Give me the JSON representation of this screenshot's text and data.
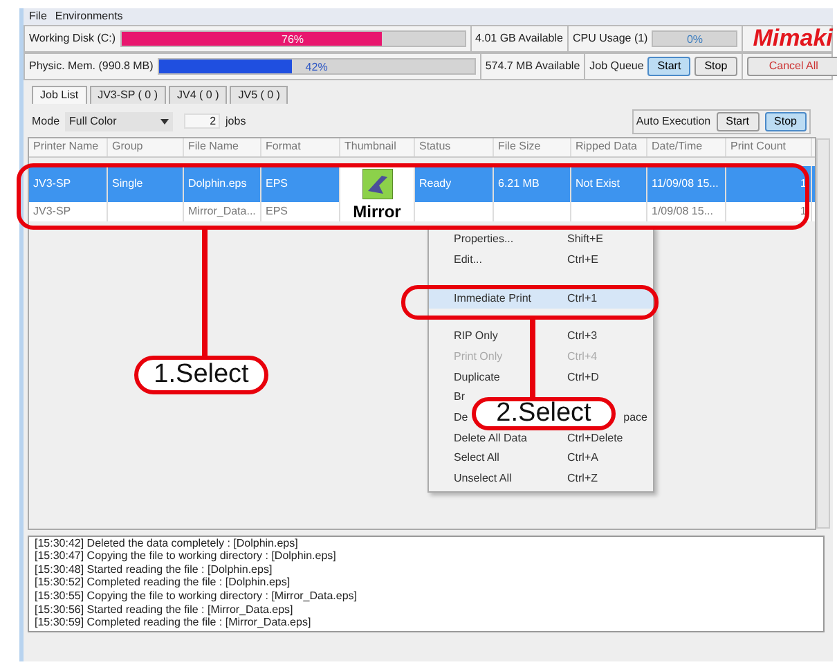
{
  "menu_bar": [
    "File",
    "Environments"
  ],
  "status_rows": [
    {
      "label": "Working Disk (C:)",
      "level": 0.76,
      "reading": "76%",
      "color": "#e8166e",
      "available": "4.01 GB Available"
    },
    {
      "label": "Physic. Mem. (990.8 MB)",
      "level": 0.42,
      "reading": "42%",
      "color": "#1f4fe0",
      "available": "574.7 MB Available"
    }
  ],
  "cpu": {
    "label": "CPU Usage (1)",
    "reading": "0%"
  },
  "logo": "Mimaki",
  "job_queue": {
    "label": "Job Queue",
    "buttons": [
      {
        "label": "Start",
        "selected": true
      },
      {
        "label": "Stop",
        "selected": false
      }
    ]
  },
  "cancel_all": "Cancel All",
  "tabs": [
    {
      "label": "Job List",
      "selected": true
    },
    {
      "label": "JV3-SP ( 0 )",
      "selected": false
    },
    {
      "label": "JV4 ( 0 )",
      "selected": false
    },
    {
      "label": "JV5 ( 0 )",
      "selected": false
    }
  ],
  "mode": {
    "label": "Mode",
    "value": "Full Color",
    "count": "2",
    "unit": "jobs"
  },
  "auto_execution": {
    "label": "Auto Execution",
    "buttons": [
      {
        "label": "Start",
        "selected": false
      },
      {
        "label": "Stop",
        "selected": true
      }
    ]
  },
  "table": {
    "columns": [
      "Printer Name",
      "Group",
      "File Name",
      "Format",
      "Thumbnail",
      "Status",
      "File Size",
      "Ripped Data",
      "Date/Time",
      "Print Count"
    ],
    "rows": [
      {
        "selected": true,
        "cells": [
          "JV3-SP",
          "Single",
          "Dolphin.eps",
          "EPS",
          {
            "kind": "image"
          },
          "Ready",
          "6.21 MB",
          "Not Exist",
          "11/09/08 15...",
          "1"
        ]
      },
      {
        "selected": false,
        "cells": [
          "JV3-SP",
          null,
          "Mirror_Data...",
          "EPS",
          {
            "kind": "text",
            "text": "Mirror"
          },
          null,
          null,
          null,
          "1/09/08 15...",
          "1"
        ]
      }
    ]
  },
  "context_menu": [
    {
      "kind": "item",
      "label": "Properties...",
      "shortcut": "Shift+E",
      "selected": false,
      "disabled": false
    },
    {
      "kind": "item",
      "label": "Edit...",
      "shortcut": "Ctrl+E",
      "selected": false,
      "disabled": false
    },
    {
      "kind": "gap"
    },
    {
      "kind": "item",
      "label": "Immediate Print",
      "shortcut": "Ctrl+1",
      "selected": true,
      "disabled": false
    },
    {
      "kind": "gap"
    },
    {
      "kind": "item",
      "label": "RIP Only",
      "shortcut": "Ctrl+3",
      "selected": false,
      "disabled": false
    },
    {
      "kind": "item",
      "label": "Print Only",
      "shortcut": "Ctrl+4",
      "selected": false,
      "disabled": true
    },
    {
      "kind": "item",
      "label": "Duplicate",
      "shortcut": "Ctrl+D",
      "selected": false,
      "disabled": false
    },
    {
      "kind": "cut",
      "label": "Br"
    },
    {
      "kind": "cut",
      "label": "De",
      "shortcut": "pace"
    },
    {
      "kind": "item",
      "label": "Delete All Data",
      "shortcut": "Ctrl+Delete",
      "selected": false,
      "disabled": false
    },
    {
      "kind": "item",
      "label": "Select All",
      "shortcut": "Ctrl+A",
      "selected": false,
      "disabled": false
    },
    {
      "kind": "item",
      "label": "Unselect All",
      "shortcut": "Ctrl+Z",
      "selected": false,
      "disabled": false
    }
  ],
  "log": [
    "[15:30:42] Deleted the data completely : [Dolphin.eps]",
    "[15:30:47] Copying the file to working directory : [Dolphin.eps]",
    "[15:30:48] Started reading the file : [Dolphin.eps]",
    "[15:30:52] Completed reading the file : [Dolphin.eps]",
    "[15:30:55] Copying the file to working directory : [Mirror_Data.eps]",
    "[15:30:56] Started reading the file : [Mirror_Data.eps]",
    "[15:30:59] Completed reading the file : [Mirror_Data.eps]"
  ],
  "annotations": [
    {
      "label": "1.Select"
    },
    {
      "label": "2.Select"
    }
  ]
}
